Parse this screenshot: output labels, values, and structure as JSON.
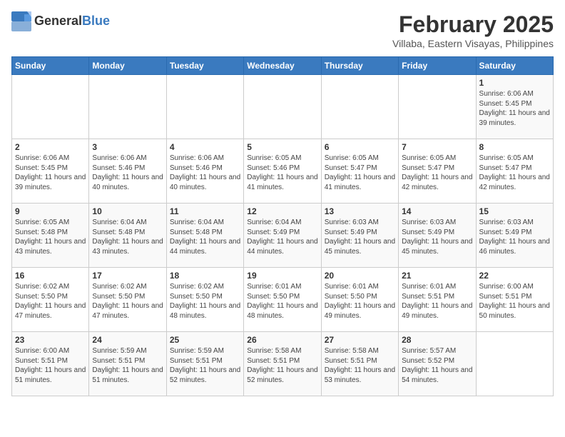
{
  "header": {
    "logo_general": "General",
    "logo_blue": "Blue",
    "month_title": "February 2025",
    "location": "Villaba, Eastern Visayas, Philippines"
  },
  "days_of_week": [
    "Sunday",
    "Monday",
    "Tuesday",
    "Wednesday",
    "Thursday",
    "Friday",
    "Saturday"
  ],
  "weeks": [
    [
      {
        "day": "",
        "info": ""
      },
      {
        "day": "",
        "info": ""
      },
      {
        "day": "",
        "info": ""
      },
      {
        "day": "",
        "info": ""
      },
      {
        "day": "",
        "info": ""
      },
      {
        "day": "",
        "info": ""
      },
      {
        "day": "1",
        "info": "Sunrise: 6:06 AM\nSunset: 5:45 PM\nDaylight: 11 hours and 39 minutes."
      }
    ],
    [
      {
        "day": "2",
        "info": "Sunrise: 6:06 AM\nSunset: 5:45 PM\nDaylight: 11 hours and 39 minutes."
      },
      {
        "day": "3",
        "info": "Sunrise: 6:06 AM\nSunset: 5:46 PM\nDaylight: 11 hours and 40 minutes."
      },
      {
        "day": "4",
        "info": "Sunrise: 6:06 AM\nSunset: 5:46 PM\nDaylight: 11 hours and 40 minutes."
      },
      {
        "day": "5",
        "info": "Sunrise: 6:05 AM\nSunset: 5:46 PM\nDaylight: 11 hours and 41 minutes."
      },
      {
        "day": "6",
        "info": "Sunrise: 6:05 AM\nSunset: 5:47 PM\nDaylight: 11 hours and 41 minutes."
      },
      {
        "day": "7",
        "info": "Sunrise: 6:05 AM\nSunset: 5:47 PM\nDaylight: 11 hours and 42 minutes."
      },
      {
        "day": "8",
        "info": "Sunrise: 6:05 AM\nSunset: 5:47 PM\nDaylight: 11 hours and 42 minutes."
      }
    ],
    [
      {
        "day": "9",
        "info": "Sunrise: 6:05 AM\nSunset: 5:48 PM\nDaylight: 11 hours and 43 minutes."
      },
      {
        "day": "10",
        "info": "Sunrise: 6:04 AM\nSunset: 5:48 PM\nDaylight: 11 hours and 43 minutes."
      },
      {
        "day": "11",
        "info": "Sunrise: 6:04 AM\nSunset: 5:48 PM\nDaylight: 11 hours and 44 minutes."
      },
      {
        "day": "12",
        "info": "Sunrise: 6:04 AM\nSunset: 5:49 PM\nDaylight: 11 hours and 44 minutes."
      },
      {
        "day": "13",
        "info": "Sunrise: 6:03 AM\nSunset: 5:49 PM\nDaylight: 11 hours and 45 minutes."
      },
      {
        "day": "14",
        "info": "Sunrise: 6:03 AM\nSunset: 5:49 PM\nDaylight: 11 hours and 45 minutes."
      },
      {
        "day": "15",
        "info": "Sunrise: 6:03 AM\nSunset: 5:49 PM\nDaylight: 11 hours and 46 minutes."
      }
    ],
    [
      {
        "day": "16",
        "info": "Sunrise: 6:02 AM\nSunset: 5:50 PM\nDaylight: 11 hours and 47 minutes."
      },
      {
        "day": "17",
        "info": "Sunrise: 6:02 AM\nSunset: 5:50 PM\nDaylight: 11 hours and 47 minutes."
      },
      {
        "day": "18",
        "info": "Sunrise: 6:02 AM\nSunset: 5:50 PM\nDaylight: 11 hours and 48 minutes."
      },
      {
        "day": "19",
        "info": "Sunrise: 6:01 AM\nSunset: 5:50 PM\nDaylight: 11 hours and 48 minutes."
      },
      {
        "day": "20",
        "info": "Sunrise: 6:01 AM\nSunset: 5:50 PM\nDaylight: 11 hours and 49 minutes."
      },
      {
        "day": "21",
        "info": "Sunrise: 6:01 AM\nSunset: 5:51 PM\nDaylight: 11 hours and 49 minutes."
      },
      {
        "day": "22",
        "info": "Sunrise: 6:00 AM\nSunset: 5:51 PM\nDaylight: 11 hours and 50 minutes."
      }
    ],
    [
      {
        "day": "23",
        "info": "Sunrise: 6:00 AM\nSunset: 5:51 PM\nDaylight: 11 hours and 51 minutes."
      },
      {
        "day": "24",
        "info": "Sunrise: 5:59 AM\nSunset: 5:51 PM\nDaylight: 11 hours and 51 minutes."
      },
      {
        "day": "25",
        "info": "Sunrise: 5:59 AM\nSunset: 5:51 PM\nDaylight: 11 hours and 52 minutes."
      },
      {
        "day": "26",
        "info": "Sunrise: 5:58 AM\nSunset: 5:51 PM\nDaylight: 11 hours and 52 minutes."
      },
      {
        "day": "27",
        "info": "Sunrise: 5:58 AM\nSunset: 5:51 PM\nDaylight: 11 hours and 53 minutes."
      },
      {
        "day": "28",
        "info": "Sunrise: 5:57 AM\nSunset: 5:52 PM\nDaylight: 11 hours and 54 minutes."
      },
      {
        "day": "",
        "info": ""
      }
    ]
  ]
}
